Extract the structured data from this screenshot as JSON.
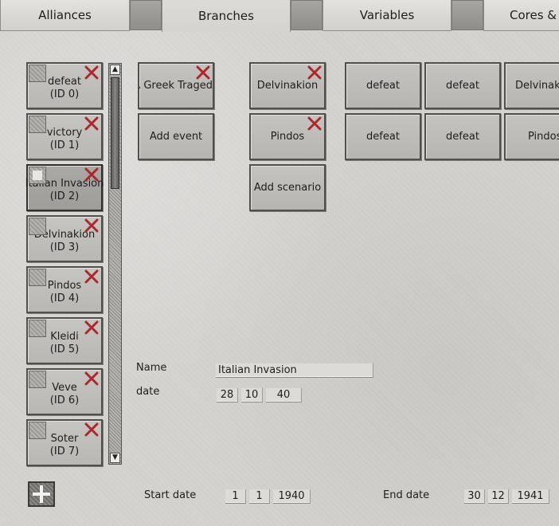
{
  "tabs": [
    {
      "label": "Alliances"
    },
    {
      "label": "Branches"
    },
    {
      "label": "Variables"
    },
    {
      "label": "Cores & U"
    }
  ],
  "events": [
    {
      "name": "defeat",
      "id": "(ID 0)"
    },
    {
      "name": "victory",
      "id": "(ID 1)"
    },
    {
      "name": "Italian Invasion",
      "id": "(ID 2)"
    },
    {
      "name": "Delvinakion",
      "id": "(ID 3)"
    },
    {
      "name": "Pindos",
      "id": "(ID 4)"
    },
    {
      "name": "Kleidi",
      "id": "(ID 5)"
    },
    {
      "name": "Veve",
      "id": "(ID 6)"
    },
    {
      "name": "Soter",
      "id": "(ID 7)"
    }
  ],
  "scrollbar": {
    "up": "▲",
    "down": "▼"
  },
  "tree": {
    "root_event": "A Greek Tragedy",
    "add_event": "Add event",
    "scenario_1": "Delvinakion",
    "scenario_2": "Pindos",
    "add_scenario": "Add scenario",
    "outcomes": {
      "r1c1": "defeat",
      "r1c2": "defeat",
      "r1c3": "Delvinakion",
      "r2c1": "defeat",
      "r2c2": "defeat",
      "r2c3": "Pindos"
    }
  },
  "detail": {
    "name_label": "Name",
    "name_value": "Italian Invasion",
    "date_label": "date",
    "date_day": "28",
    "date_month": "10",
    "date_year": "40"
  },
  "footer": {
    "start_label": "Start date",
    "start_day": "1",
    "start_month": "1",
    "start_year": "1940",
    "end_label": "End date",
    "end_day": "30",
    "end_month": "12",
    "end_year": "1941"
  },
  "colors": {
    "delete_x": "#b0272a",
    "background": "#d4d3d0"
  }
}
